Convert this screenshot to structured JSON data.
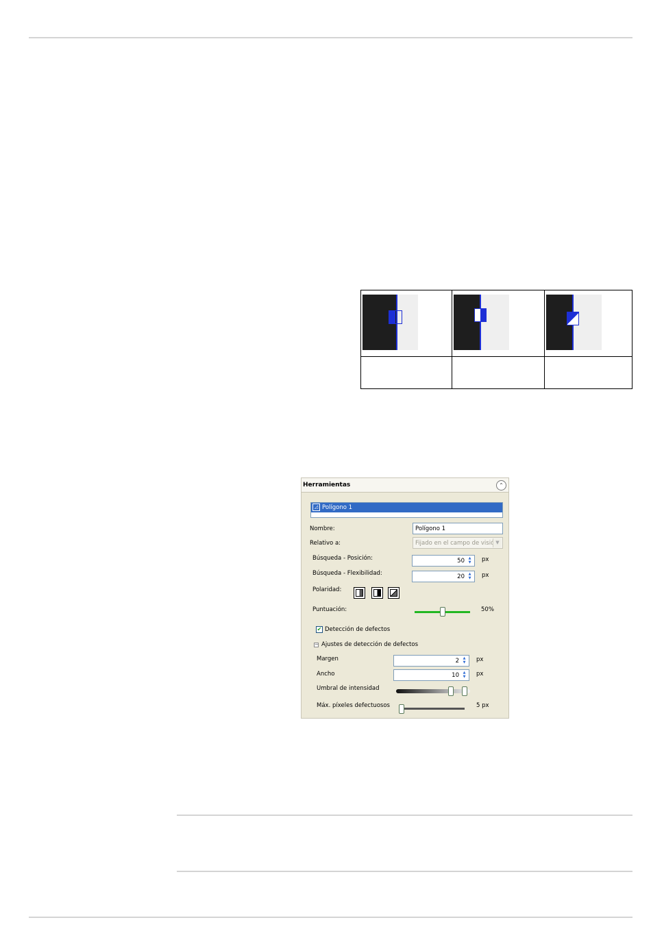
{
  "tools_panel": {
    "title": "Herramientas",
    "collapse_icon": "double-chevron-up-icon",
    "tool_list": {
      "selected_item": "Polígono 1",
      "item_icon": "polygon-tool-icon"
    },
    "fields": {
      "name": {
        "label": "Nombre:",
        "value": "Polígono 1"
      },
      "relative_to": {
        "label": "Relativo a:",
        "value": "Fijado en el campo de visión"
      },
      "search_position": {
        "label": "Búsqueda - Posición:",
        "value": "50",
        "unit": "px"
      },
      "search_flexibility": {
        "label": "Búsqueda - Flexibilidad:",
        "value": "20",
        "unit": "px"
      },
      "polarity": {
        "label": "Polaridad:",
        "options": [
          "dark-to-light-icon",
          "light-to-dark-icon",
          "any-polarity-icon"
        ]
      },
      "score": {
        "label": "Puntuación:",
        "value": "50%",
        "level": 0.5,
        "track_color": "#22b722"
      }
    },
    "defect_detection": {
      "label": "Detección de defectos",
      "checked": true
    },
    "defect_settings": {
      "label": "Ajustes de detección de defectos",
      "toggle": "−",
      "margin": {
        "label": "Margen",
        "value": "2",
        "unit": "px"
      },
      "width": {
        "label": "Ancho",
        "value": "10",
        "unit": "px"
      },
      "intensity_threshold": {
        "label": "Umbral de intensidad"
      },
      "max_defective_pixels": {
        "label": "Máx. píxeles defectuosos",
        "value": "5 px"
      }
    }
  },
  "colors": {
    "edge_blue": "#1d2fd6",
    "selection_blue": "#316ac5",
    "panel_bg": "#ece9d8"
  }
}
